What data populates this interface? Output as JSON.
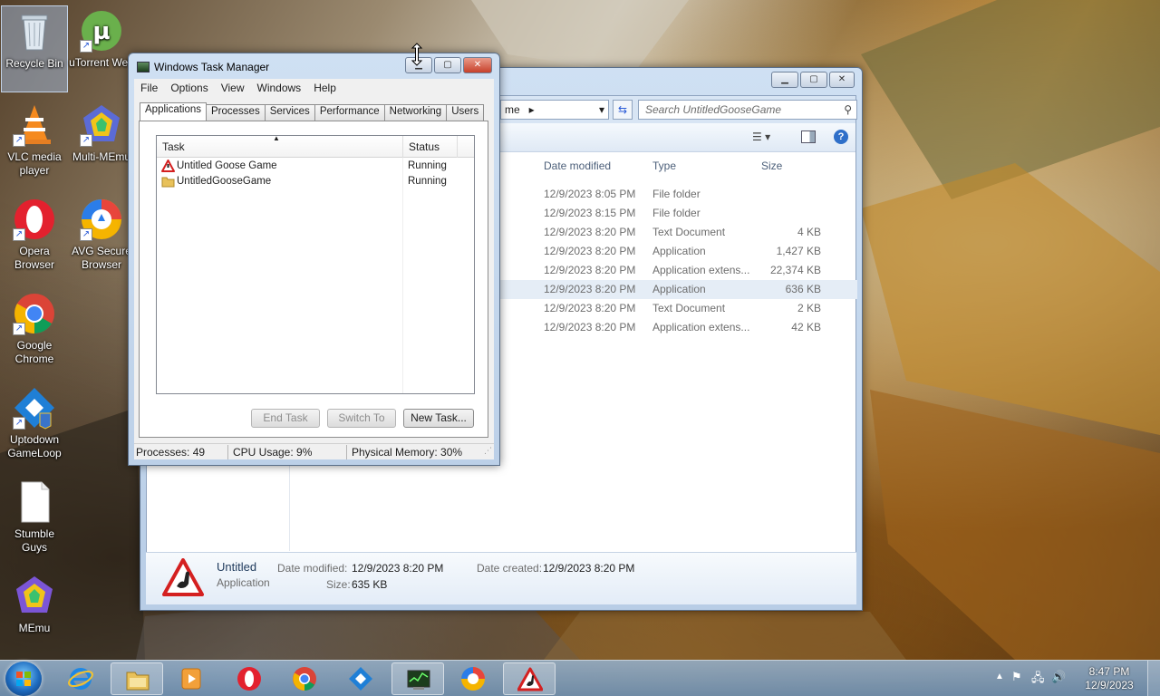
{
  "desktop": {
    "icons": [
      {
        "label": "Recycle Bin"
      },
      {
        "label": "uTorrent Web"
      },
      {
        "label": "VLC media player"
      },
      {
        "label": "Multi-MEmu"
      },
      {
        "label": "Opera Browser"
      },
      {
        "label": "AVG Secure Browser"
      },
      {
        "label": "Google Chrome"
      },
      {
        "label": "Uptodown GameLoop"
      },
      {
        "label": "Stumble Guys"
      },
      {
        "label": "MEmu"
      }
    ]
  },
  "explorer": {
    "address_tail": "me",
    "search_placeholder": "Search UntitledGooseGame",
    "columns": {
      "date": "Date modified",
      "type": "Type",
      "size": "Size"
    },
    "rows": [
      {
        "date": "12/9/2023 8:05 PM",
        "type": "File folder",
        "size": ""
      },
      {
        "date": "12/9/2023 8:15 PM",
        "type": "File folder",
        "size": ""
      },
      {
        "date": "12/9/2023 8:20 PM",
        "type": "Text Document",
        "size": "4 KB"
      },
      {
        "date": "12/9/2023 8:20 PM",
        "type": "Application",
        "size": "1,427 KB"
      },
      {
        "date": "12/9/2023 8:20 PM",
        "type": "Application extens...",
        "size": "22,374 KB"
      },
      {
        "date": "12/9/2023 8:20 PM",
        "type": "Application",
        "size": "636 KB"
      },
      {
        "date": "12/9/2023 8:20 PM",
        "type": "Text Document",
        "size": "2 KB"
      },
      {
        "date": "12/9/2023 8:20 PM",
        "type": "Application extens...",
        "size": "42 KB"
      }
    ],
    "details": {
      "name": "Untitled",
      "kind": "Application",
      "modified_label": "Date modified:",
      "modified_value": "12/9/2023 8:20 PM",
      "size_label": "Size:",
      "size_value": "635 KB",
      "created_label": "Date created:",
      "created_value": "12/9/2023 8:20 PM"
    }
  },
  "taskmgr": {
    "title": "Windows Task Manager",
    "menu": [
      "File",
      "Options",
      "View",
      "Windows",
      "Help"
    ],
    "tabs": [
      "Applications",
      "Processes",
      "Services",
      "Performance",
      "Networking",
      "Users"
    ],
    "list_headers": {
      "task": "Task",
      "status": "Status"
    },
    "tasks": [
      {
        "name": "Untitled Goose Game",
        "status": "Running"
      },
      {
        "name": "UntitledGooseGame",
        "status": "Running"
      }
    ],
    "buttons": {
      "end_task": "End Task",
      "switch_to": "Switch To",
      "new_task": "New Task..."
    },
    "status": {
      "processes": "Processes: 49",
      "cpu": "CPU Usage: 9%",
      "memory": "Physical Memory: 30%"
    }
  },
  "taskbar": {
    "time": "8:47 PM",
    "date": "12/9/2023"
  }
}
